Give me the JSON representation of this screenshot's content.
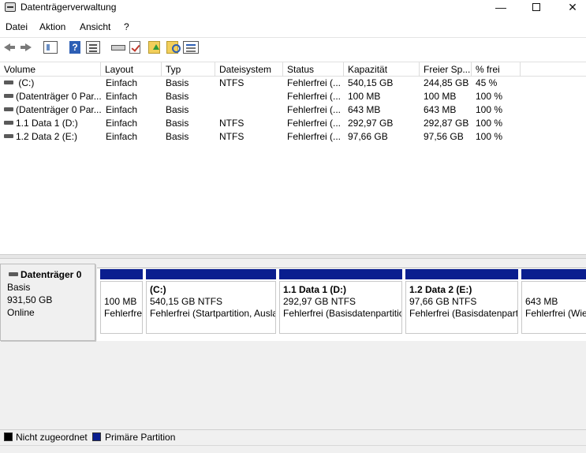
{
  "window": {
    "title": "Datenträgerverwaltung",
    "minimize_label": "—",
    "close_label": "✕"
  },
  "menu": [
    {
      "label": "Datei"
    },
    {
      "label": "Aktion"
    },
    {
      "label": "Ansicht"
    },
    {
      "label": "?"
    }
  ],
  "toolbar": {
    "help_label": "?",
    "icons": [
      "back-icon",
      "forward-icon",
      "show-hide-console-tree-icon",
      "help-icon",
      "properties-icon",
      "rescan-disks-icon",
      "checklist-icon",
      "folder-up-icon",
      "folder-search-icon",
      "settings-list-icon"
    ]
  },
  "table": {
    "columns": [
      "Volume",
      "Layout",
      "Typ",
      "Dateisystem",
      "Status",
      "Kapazität",
      "Freier Sp...",
      "% frei"
    ],
    "rows": [
      {
        "volume": " (C:)",
        "layout": "Einfach",
        "typ": "Basis",
        "dateisystem": "NTFS",
        "status": "Fehlerfrei (...",
        "kapazitaet": "540,15 GB",
        "frei": "244,85 GB",
        "prozent": "45 %"
      },
      {
        "volume": "(Datenträger 0 Par...",
        "layout": "Einfach",
        "typ": "Basis",
        "dateisystem": "",
        "status": "Fehlerfrei (...",
        "kapazitaet": "100 MB",
        "frei": "100 MB",
        "prozent": "100 %"
      },
      {
        "volume": "(Datenträger 0 Par...",
        "layout": "Einfach",
        "typ": "Basis",
        "dateisystem": "",
        "status": "Fehlerfrei (...",
        "kapazitaet": "643 MB",
        "frei": "643 MB",
        "prozent": "100 %"
      },
      {
        "volume": "1.1 Data 1 (D:)",
        "layout": "Einfach",
        "typ": "Basis",
        "dateisystem": "NTFS",
        "status": "Fehlerfrei (...",
        "kapazitaet": "292,97 GB",
        "frei": "292,87 GB",
        "prozent": "100 %"
      },
      {
        "volume": "1.2 Data 2 (E:)",
        "layout": "Einfach",
        "typ": "Basis",
        "dateisystem": "NTFS",
        "status": "Fehlerfrei (...",
        "kapazitaet": "97,66 GB",
        "frei": "97,56 GB",
        "prozent": "100 %"
      }
    ]
  },
  "disk": {
    "name": "Datenträger 0",
    "type": "Basis",
    "size": "931,50 GB",
    "state": "Online",
    "partitions": [
      {
        "title": "",
        "size": "100 MB",
        "status": "Fehlerfrei (EFI-Systempartition)"
      },
      {
        "title": " (C:)",
        "size": "540,15 GB NTFS",
        "status": "Fehlerfrei (Startpartition, Auslagerungsdatei)"
      },
      {
        "title": "1.1 Data 1  (D:)",
        "size": "292,97 GB NTFS",
        "status": "Fehlerfrei (Basisdatenpartition)"
      },
      {
        "title": "1.2 Data 2  (E:)",
        "size": "97,66 GB NTFS",
        "status": "Fehlerfrei (Basisdatenpartition)"
      },
      {
        "title": "",
        "size": "643 MB",
        "status": "Fehlerfrei (Wiederherstellungspartition)"
      }
    ]
  },
  "legend": [
    {
      "label": "Nicht zugeordnet",
      "color": "#000000"
    },
    {
      "label": "Primäre Partition",
      "color": "#0a1e8f"
    }
  ]
}
